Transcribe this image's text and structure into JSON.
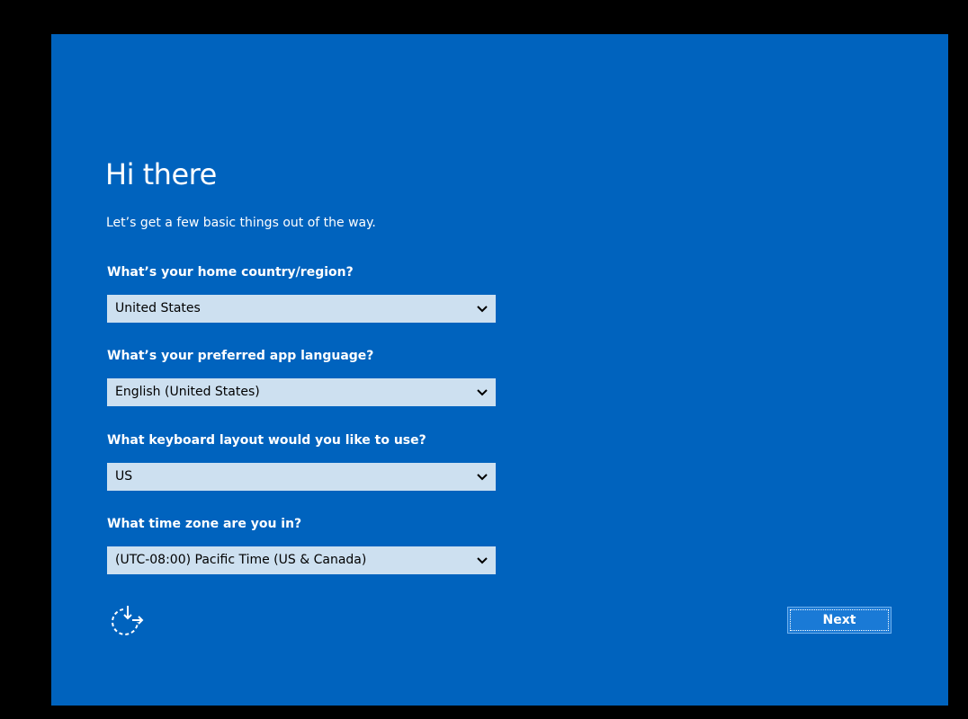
{
  "header": {
    "title": "Hi there",
    "subtitle": "Let’s get a few basic things out of the way."
  },
  "fields": [
    {
      "label": "What’s your home country/region?",
      "value": "United States"
    },
    {
      "label": "What’s your preferred app language?",
      "value": "English (United States)"
    },
    {
      "label": "What keyboard layout would you like to use?",
      "value": "US"
    },
    {
      "label": "What time zone are you in?",
      "value": "(UTC-08:00) Pacific Time (US & Canada)"
    }
  ],
  "footer": {
    "accessibility_icon": "ease-of-access-icon",
    "next_label": "Next"
  },
  "colors": {
    "background": "#0063be",
    "dropdown": "#cde0f0",
    "button": "#1a7ad6"
  }
}
